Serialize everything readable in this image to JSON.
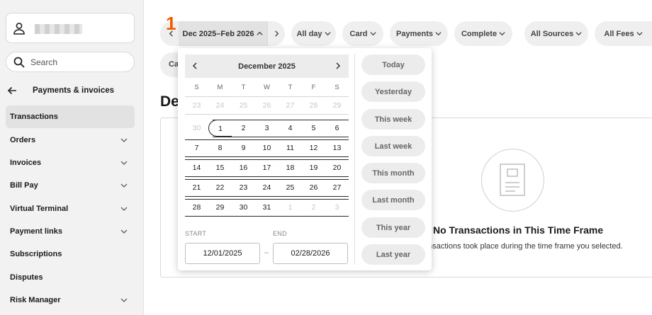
{
  "sidebar": {
    "search_placeholder": "Search",
    "back_label": "Payments & invoices",
    "items": [
      {
        "label": "Transactions",
        "has_chevron": false
      },
      {
        "label": "Orders",
        "has_chevron": true
      },
      {
        "label": "Invoices",
        "has_chevron": true
      },
      {
        "label": "Bill Pay",
        "has_chevron": true
      },
      {
        "label": "Virtual Terminal",
        "has_chevron": true
      },
      {
        "label": "Payment links",
        "has_chevron": true
      },
      {
        "label": "Subscriptions",
        "has_chevron": false
      },
      {
        "label": "Disputes",
        "has_chevron": false
      },
      {
        "label": "Risk Manager",
        "has_chevron": true
      }
    ]
  },
  "badge": "1",
  "filters": {
    "date_range": "Dec 2025–Feb 2026",
    "time": "All day",
    "method": "Card",
    "type": "Payments",
    "status": "Complete",
    "sources": "All Sources",
    "fees": "All Fees",
    "second_row_partial": "Ca"
  },
  "main": {
    "title_partial": "De",
    "empty_title": "No Transactions in This Time Frame",
    "empty_sub": "ansactions took place during the time frame you selected."
  },
  "picker": {
    "month": "December 2025",
    "weekdays": [
      "S",
      "M",
      "T",
      "W",
      "T",
      "F",
      "S"
    ],
    "weeks": [
      [
        "23",
        "24",
        "25",
        "26",
        "27",
        "28",
        "29"
      ],
      [
        "30",
        "1",
        "2",
        "3",
        "4",
        "5",
        "6"
      ],
      [
        "7",
        "8",
        "9",
        "10",
        "11",
        "12",
        "13"
      ],
      [
        "14",
        "15",
        "16",
        "17",
        "18",
        "19",
        "20"
      ],
      [
        "21",
        "22",
        "23",
        "24",
        "25",
        "26",
        "27"
      ],
      [
        "28",
        "29",
        "30",
        "31",
        "1",
        "2",
        "3"
      ]
    ],
    "start_label": "START",
    "end_label": "END",
    "start_value": "12/01/2025",
    "end_value": "02/28/2026",
    "separator": "–",
    "quick_ranges": [
      "Today",
      "Yesterday",
      "This week",
      "Last week",
      "This month",
      "Last month",
      "This year",
      "Last year"
    ]
  }
}
